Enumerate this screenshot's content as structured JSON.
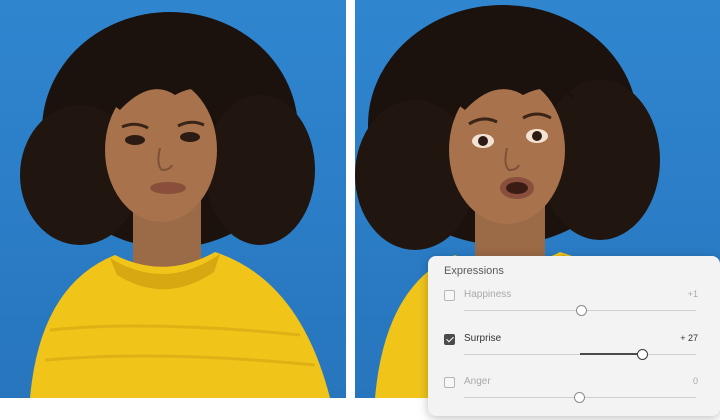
{
  "panel": {
    "title": "Expressions",
    "items": [
      {
        "label": "Happiness",
        "value_text": "+1",
        "value": 1,
        "checked": false,
        "enabled": false
      },
      {
        "label": "Surprise",
        "value_text": "+ 27",
        "value": 27,
        "checked": true,
        "enabled": true
      },
      {
        "label": "Anger",
        "value_text": "0",
        "value": 0,
        "checked": false,
        "enabled": false
      }
    ],
    "slider_range": [
      -50,
      50
    ]
  },
  "colors": {
    "background_blue": "#2f86cf",
    "sweater_yellow": "#f0c419",
    "panel_bg": "#f3f3f3"
  }
}
